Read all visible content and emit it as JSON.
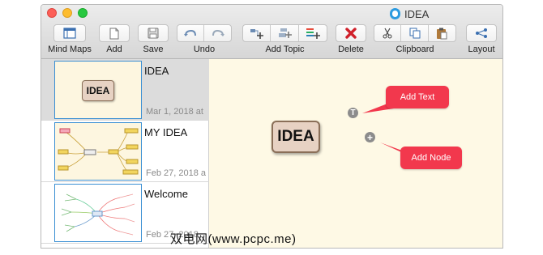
{
  "window": {
    "title": "IDEA"
  },
  "toolbar": {
    "mind_maps": "Mind Maps",
    "add": "Add",
    "save": "Save",
    "undo": "Undo",
    "add_topic": "Add Topic",
    "delete": "Delete",
    "clipboard": "Clipboard",
    "layout": "Layout"
  },
  "sidebar": {
    "documents": [
      {
        "title": "IDEA",
        "date": "Mar 1, 2018 at",
        "thumb_label": "IDEA"
      },
      {
        "title": "MY IDEA",
        "date": "Feb 27, 2018 a"
      },
      {
        "title": "Welcome",
        "date": "Feb 27, 2018"
      }
    ]
  },
  "canvas": {
    "root_topic": "IDEA",
    "add_text_callout": "Add Text",
    "add_node_callout": "Add Node",
    "text_handle_glyph": "T",
    "node_handle_glyph": "+"
  },
  "watermark": "双电网(www.pcpc.me)",
  "colors": {
    "callout": "#f2384d",
    "canvas_bg": "#fef9e5",
    "selection_border": "#3a8fd3",
    "root_fill": "#e7d2c3"
  }
}
